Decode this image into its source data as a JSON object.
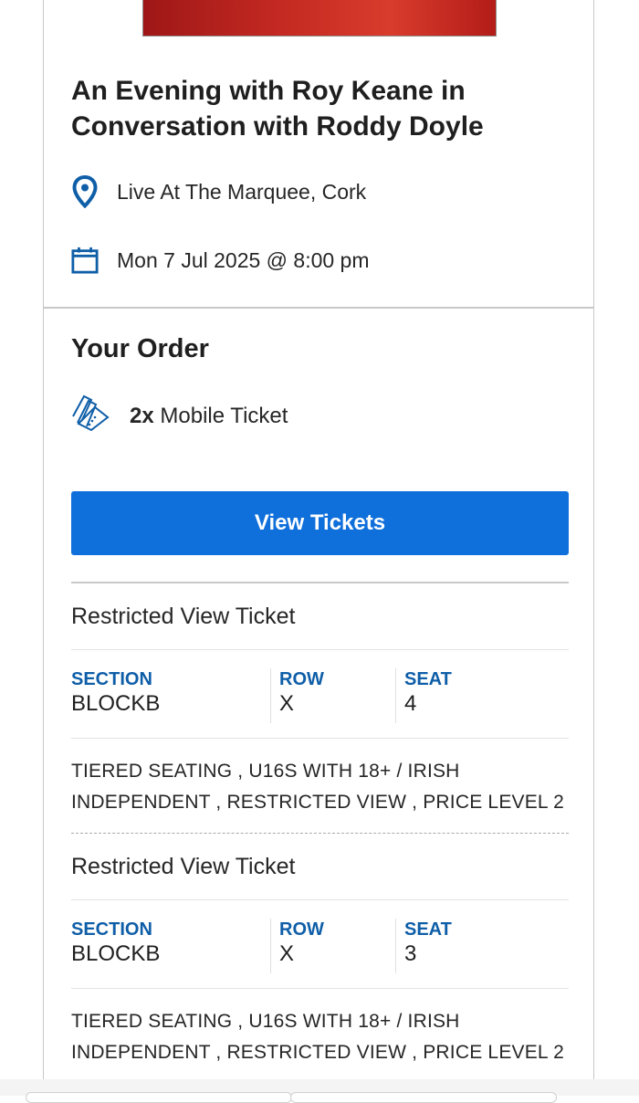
{
  "event": {
    "title": "An Evening with Roy Keane in Conversation with Roddy Doyle",
    "venue": "Live At The Marquee, Cork",
    "datetime": "Mon 7 Jul 2025 @ 8:00 pm"
  },
  "order": {
    "heading": "Your Order",
    "quantity": "2x",
    "ticket_kind": "Mobile Ticket",
    "view_button_label": "View Tickets"
  },
  "tickets": [
    {
      "type": "Restricted View Ticket",
      "section_label": "SECTION",
      "section": "BLOCKB",
      "row_label": "ROW",
      "row": "X",
      "seat_label": "SEAT",
      "seat": "4",
      "description": "TIERED SEATING , U16S WITH 18+ / IRISH INDEPENDENT , RESTRICTED VIEW , PRICE LEVEL 2"
    },
    {
      "type": "Restricted View Ticket",
      "section_label": "SECTION",
      "section": "BLOCKB",
      "row_label": "ROW",
      "row": "X",
      "seat_label": "SEAT",
      "seat": "3",
      "description": "TIERED SEATING , U16S WITH 18+ / IRISH INDEPENDENT , RESTRICTED VIEW , PRICE LEVEL 2"
    }
  ],
  "icons": {
    "venue": "location-pin-icon",
    "date": "calendar-icon",
    "ticket": "tickets-icon"
  },
  "colors": {
    "accent": "#0f6fdb",
    "label_blue": "#0f5ea8",
    "hero_red": "#c52a22"
  }
}
